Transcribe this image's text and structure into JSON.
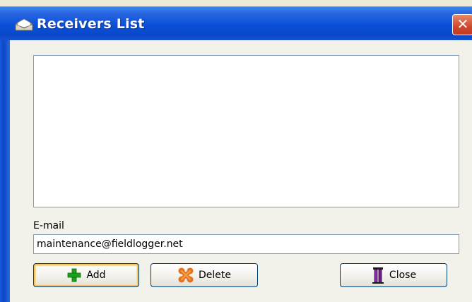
{
  "window": {
    "title": "Receivers List",
    "close_glyph": "✕",
    "title_icon": "envelope-icon"
  },
  "receivers": {
    "items": []
  },
  "email": {
    "label": "E-mail",
    "value": "maintenance@fieldlogger.net"
  },
  "buttons": {
    "add_label": "Add",
    "add_icon": "plus-icon",
    "delete_label": "Delete",
    "delete_icon": "delete-x-icon",
    "close_label": "Close",
    "close_icon": "exit-door-icon"
  },
  "colors": {
    "titlebar": "#0a4fd8",
    "add_icon": "#1aa31a",
    "delete_icon": "#e8731e",
    "close_icon": "#8a2aa8"
  }
}
